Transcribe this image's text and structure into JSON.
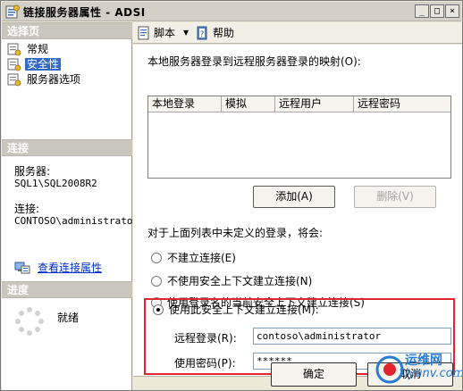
{
  "window": {
    "title": "链接服务器属性 - ADSI"
  },
  "titlebar_buttons": {
    "minimize": "_",
    "maximize": "□",
    "close": "×"
  },
  "left": {
    "pages_header": "选择页",
    "pages": [
      {
        "label": "常规",
        "icon": "page-icon"
      },
      {
        "label": "安全性",
        "icon": "page-icon",
        "selected": true
      },
      {
        "label": "服务器选项",
        "icon": "page-icon"
      }
    ],
    "connection_header": "连接",
    "server_label": "服务器:",
    "server_value": "SQL1\\SQL2008R2",
    "connection_label": "连接:",
    "connection_value": "CONTOSO\\administrator",
    "view_connection_link": "查看连接属性",
    "progress_header": "进度",
    "progress_status": "就绪"
  },
  "toolbar": {
    "script_label": "脚本",
    "help_label": "帮助"
  },
  "security": {
    "mapping_label": "本地服务器登录到远程服务器登录的映射(O):",
    "columns": [
      "本地登录",
      "模拟",
      "远程用户",
      "远程密码"
    ],
    "add_button": "添加(A)",
    "delete_button": "删除(V)",
    "undefined_label": "对于上面列表中未定义的登录，将会:",
    "options": [
      {
        "label": "不建立连接(E)",
        "checked": false
      },
      {
        "label": "不使用安全上下文建立连接(N)",
        "checked": false
      },
      {
        "label": "使用登录名的当前安全上下文建立连接(S)",
        "checked": false
      },
      {
        "label": "使用此安全上下文建立连接(M):",
        "checked": true
      }
    ],
    "remote_login_label": "远程登录(R):",
    "remote_login_value": "contoso\\administrator",
    "password_label": "使用密码(P):",
    "password_value": "******"
  },
  "footer": {
    "ok_button": "确定",
    "cancel_button": "取消"
  },
  "watermark": {
    "text": "运维网",
    "url": "iyunv.com"
  },
  "colors": {
    "highlight_border": "#e0262b",
    "selection": "#3169c6",
    "link": "#0033cc"
  }
}
